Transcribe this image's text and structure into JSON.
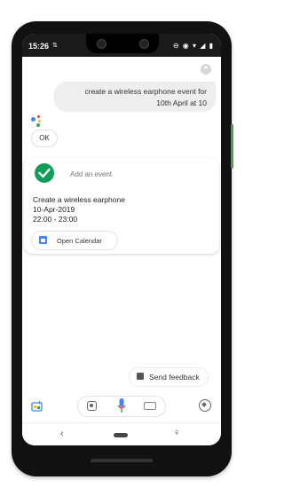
{
  "status_bar": {
    "time": "15:26",
    "sim_indicator": "⇅",
    "icons": "⊖ ◉ ▾ ◢ ▮"
  },
  "conversation": {
    "user_query_line1": "create a wireless earphone event for",
    "user_query_line2": "10th April at 10",
    "assistant_reply": "OK"
  },
  "event_card": {
    "status_label": "Add an event",
    "title": "Create a wireless earphone",
    "date": "10-Apr-2019",
    "time_range": "22:00 - 23:00",
    "open_calendar_label": "Open Calendar"
  },
  "feedback": {
    "label": "Send feedback"
  },
  "nav": {
    "back_glyph": "‹",
    "accessibility_glyph": "♀"
  },
  "colors": {
    "check_green": "#0f9d58",
    "calendar_blue": "#4285f4",
    "ga_blue": "#4285f4",
    "ga_red": "#ea4335",
    "ga_yellow": "#fbbc05",
    "ga_green": "#34a853"
  }
}
